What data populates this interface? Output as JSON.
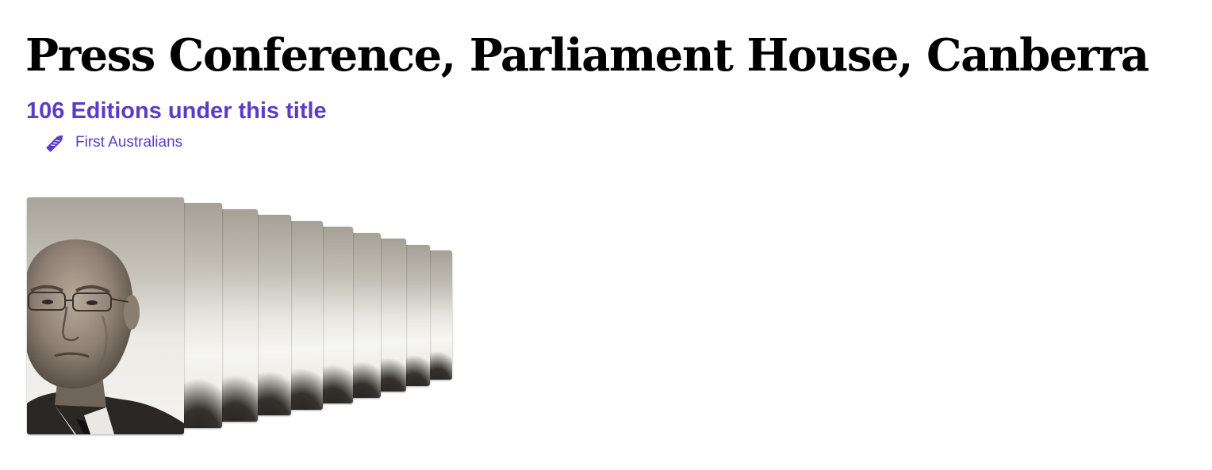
{
  "title": "Press Conference, Parliament House, Canberra",
  "editions_label": "106 Editions under this title",
  "tag": {
    "icon": "pencil-icon",
    "label": "First Australians"
  },
  "covers": {
    "count": 10,
    "alt": "Edition cover"
  },
  "colors": {
    "accent": "#5b3cc4",
    "title": "#000000"
  }
}
